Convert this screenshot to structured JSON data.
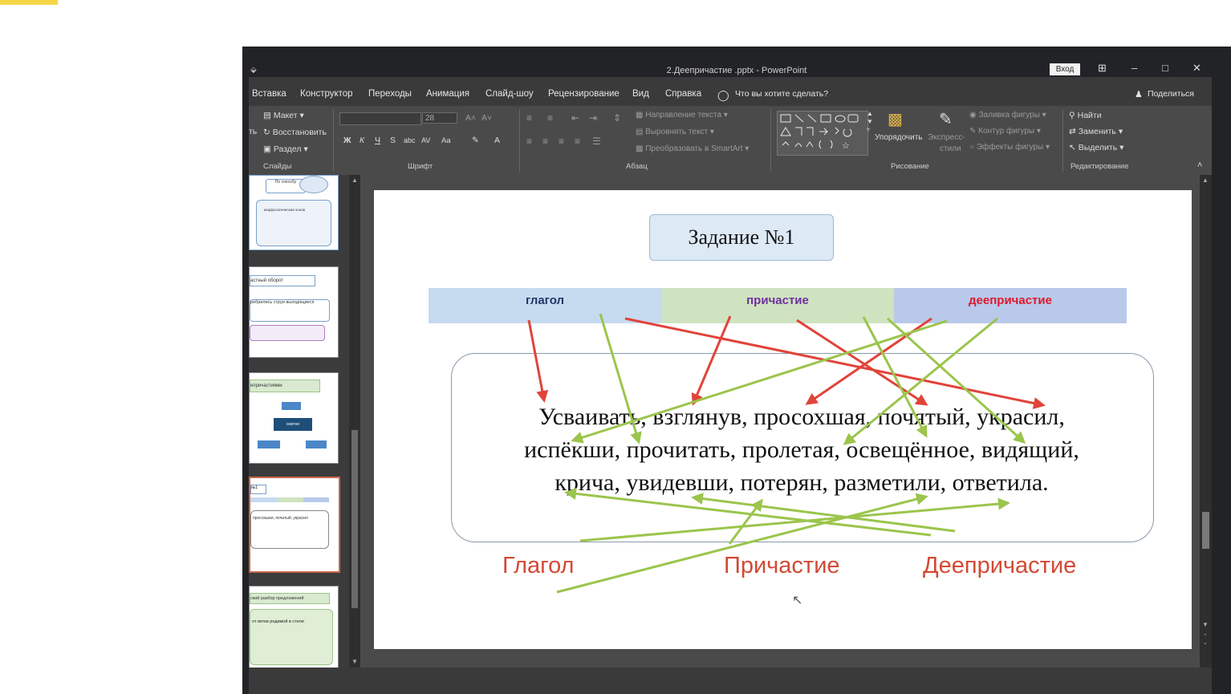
{
  "window": {
    "title": "2.Деепричастие .pptx - PowerPoint",
    "signin": "Вход",
    "quick_access": "⬙",
    "controls": [
      "⊞",
      "–",
      "□",
      "✕"
    ]
  },
  "menu": {
    "tabs": [
      "Вставка",
      "Конструктор",
      "Переходы",
      "Анимация",
      "Слайд-шоу",
      "Рецензирование",
      "Вид",
      "Справка"
    ],
    "tell_me": "Что вы хотите сделать?",
    "share": "Поделиться"
  },
  "ribbon": {
    "slides": {
      "layout": "Макет",
      "reset": "Восстановить",
      "section": "Раздел",
      "left_fragment": "ть",
      "group": "Слайды"
    },
    "font": {
      "name": "",
      "size": "28",
      "bold": "Ж",
      "italic": "К",
      "underline": "Ч",
      "strike": "S",
      "abc": "abc",
      "spacing": "AV",
      "case": "Aa",
      "grow": "A˄",
      "shrink": "A˅",
      "color": "A",
      "group": "Шрифт"
    },
    "paragraph": {
      "text_direction": "Направление текста",
      "align_text": "Выровнять текст",
      "smartart": "Преобразовать в SmartArt",
      "group": "Абзац"
    },
    "drawing": {
      "arrange": "Упорядочить",
      "quick_styles_1": "Экспресс-",
      "quick_styles_2": "стили",
      "fill": "Заливка фигуры",
      "outline": "Контур фигуры",
      "effects": "Эффекты фигуры",
      "group": "Рисование"
    },
    "editing": {
      "find": "Найти",
      "replace": "Заменить",
      "select": "Выделить",
      "group": "Редактирование"
    }
  },
  "thumbnails": [
    {
      "line1": "По способу",
      "line2": "морфологическая основ"
    },
    {
      "line1": "астный оборот",
      "line2": "ребрились струи выходящиеся"
    },
    {
      "line1": "епричастиями",
      "line2": "сметно"
    },
    {
      "line1": "№1",
      "line2": "просохшая, початый, украсил"
    },
    {
      "line1": "ский разбор предложений",
      "line2": "от ветки родимой в стели"
    }
  ],
  "slide": {
    "title": "Задание №1",
    "header": [
      {
        "label": "глагол",
        "bg": "#c6daf0",
        "color": "#1f3864"
      },
      {
        "label": "причастие",
        "bg": "#cfe3c0",
        "color": "#7030a0"
      },
      {
        "label": "деепричастие",
        "bg": "#b8c9ea",
        "color": "#e0182c"
      }
    ],
    "sentence": {
      "line1": "Усваивать, взглянув, просохшая, почятый, украсил,",
      "line2": "испёкши, прочитать, пролетая, освещённое, видящий,",
      "line3": "крича, увидевши, потерян, разметили, ответила."
    },
    "labels": {
      "verb": "Глагол",
      "participle": "Причастие",
      "gerund": "Деепричастие"
    }
  },
  "colors": {
    "red_arrow": "#e0443a",
    "green_arrow": "#9bc54c",
    "app_dark": "#222326",
    "ribbon": "#4a4a4a",
    "label_red": "#d24a35",
    "accent_yellow": "#f5d547"
  }
}
